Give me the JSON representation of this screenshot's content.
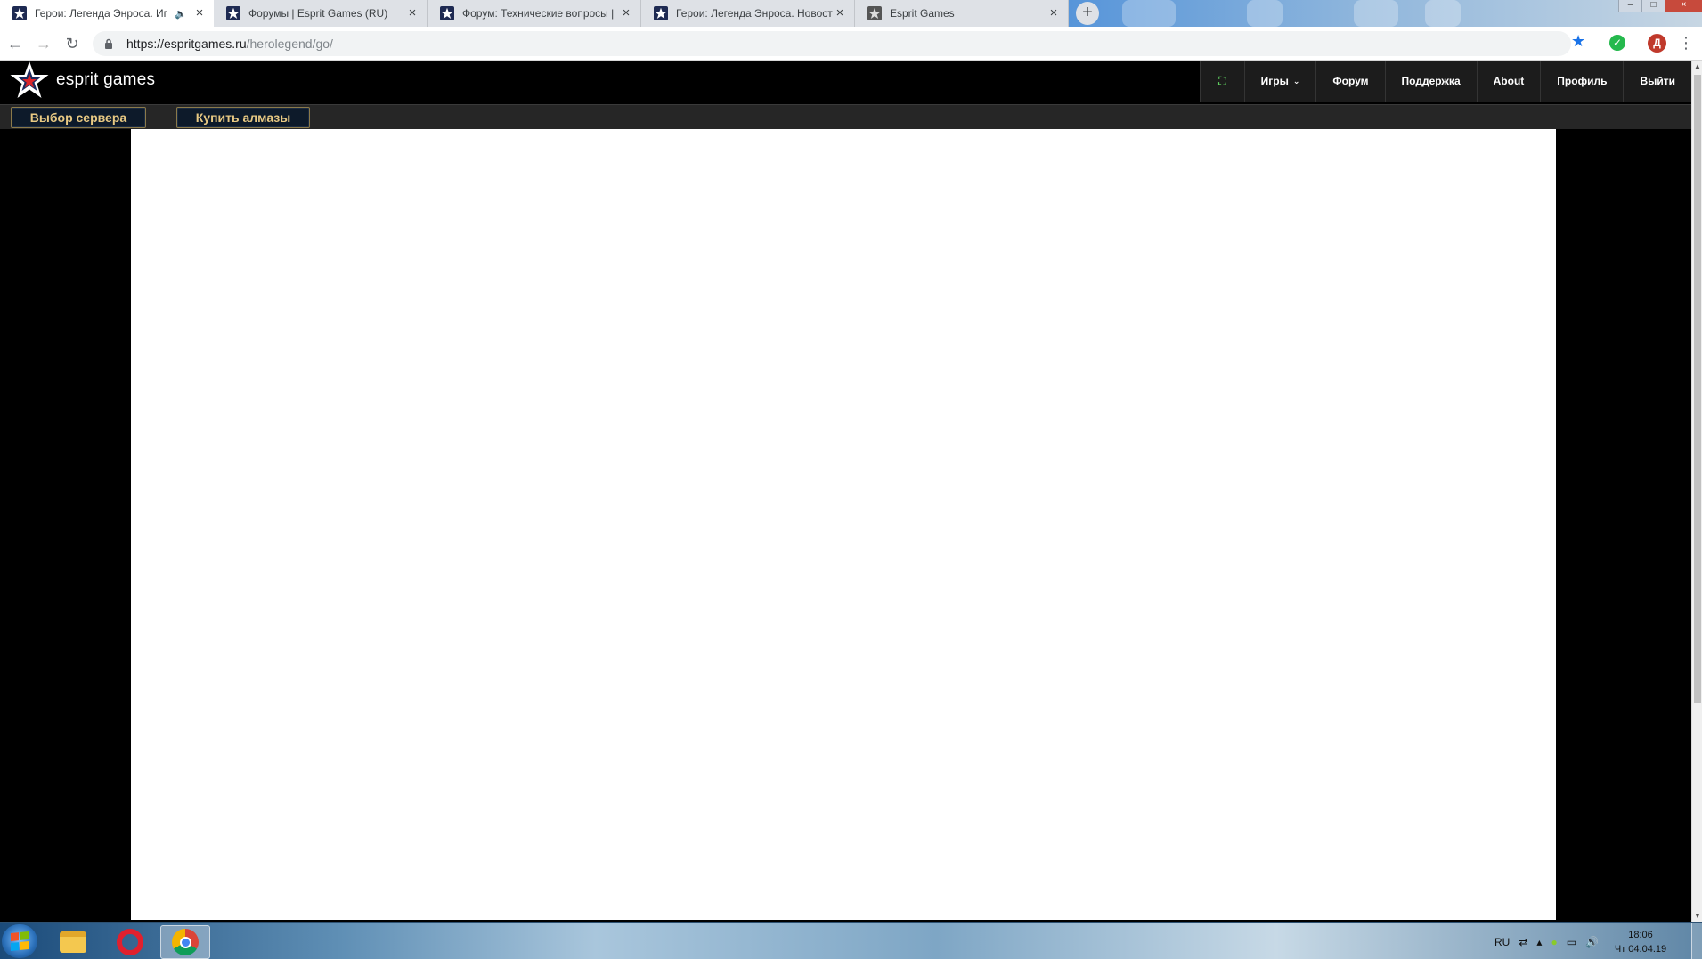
{
  "browser": {
    "tabs": [
      {
        "title": "Герои: Легенда Энроса. Иг",
        "active": true,
        "audio": true
      },
      {
        "title": "Форумы | Esprit Games (RU)",
        "active": false
      },
      {
        "title": "Форум: Технические вопросы |",
        "active": false
      },
      {
        "title": "Герои: Легенда Энроса. Новост",
        "active": false
      },
      {
        "title": "Esprit Games",
        "active": false
      }
    ],
    "new_tab_label": "+",
    "window_controls": {
      "minimize": "–",
      "maximize": "□",
      "close": "×"
    },
    "nav": {
      "back": "←",
      "forward": "→",
      "reload": "↻"
    },
    "address": {
      "host": "https://espritgames.ru",
      "path": "/herolegend/go/"
    },
    "bookmark_star": "★",
    "extension_check": "✓",
    "profile_initial": "Д",
    "menu_dots": "⋮"
  },
  "site": {
    "logo_text": "esprit games",
    "fullscreen_icon": "⛶",
    "nav_items": [
      {
        "label": "Игры",
        "caret": "⌄"
      },
      {
        "label": "Форум"
      },
      {
        "label": "Поддержка"
      },
      {
        "label": "About"
      },
      {
        "label": "Профиль"
      },
      {
        "label": "Выйти"
      }
    ],
    "game_buttons": [
      {
        "label": "Выбор сервера"
      },
      {
        "label": "Купить алмазы"
      }
    ]
  },
  "scrollbar": {
    "up": "▲",
    "down": "▼"
  },
  "taskbar": {
    "tray": {
      "lang": "RU",
      "icons": [
        "⇄",
        "▴",
        "●",
        "▭",
        "🔊"
      ],
      "time": "18:06",
      "date": "Чт 04.04.19"
    }
  },
  "colors": {
    "site_bg": "#000000",
    "nav_bg": "#1c1c1c",
    "game_button_text": "#e8c983",
    "game_button_border": "#8b7a4a",
    "game_frame": "#ffffff",
    "browser_accent": "#1a73e8"
  }
}
